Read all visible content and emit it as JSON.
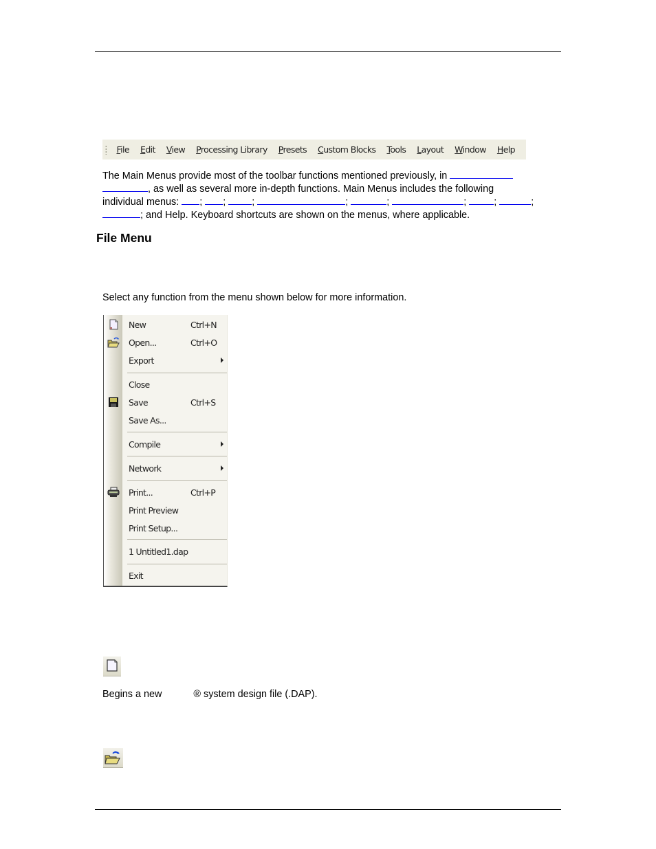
{
  "menubar": {
    "items": [
      "File",
      "Edit",
      "View",
      "Processing Library",
      "Presets",
      "Custom Blocks",
      "Tools",
      "Layout",
      "Window",
      "Help"
    ]
  },
  "intro": {
    "line1": "The Main Menus provide most of the toolbar functions mentioned previously, in ",
    "line2": ", as well as several more in-depth functions. Main Menus includes the following",
    "line3": "individual menus: ",
    "sep": ";",
    "line4": "; and Help. Keyboard shortcuts are shown on the menus, where applicable."
  },
  "file_menu_heading": "File Menu",
  "select_text": "Select any function from the menu shown below for more information.",
  "file_menu": {
    "items": [
      {
        "label": "New",
        "shortcut": "Ctrl+N",
        "icon": "new-document-icon",
        "submenu": false
      },
      {
        "label": "Open...",
        "shortcut": "Ctrl+O",
        "icon": "open-folder-icon",
        "submenu": false
      },
      {
        "label": "Export",
        "shortcut": "",
        "icon": "",
        "submenu": true
      },
      {
        "label": "Close",
        "shortcut": "",
        "icon": "",
        "submenu": false
      },
      {
        "label": "Save",
        "shortcut": "Ctrl+S",
        "icon": "floppy-disk-icon",
        "submenu": false
      },
      {
        "label": "Save As...",
        "shortcut": "",
        "icon": "",
        "submenu": false
      },
      {
        "label": "Compile",
        "shortcut": "",
        "icon": "",
        "submenu": true
      },
      {
        "label": "Network",
        "shortcut": "",
        "icon": "",
        "submenu": true
      },
      {
        "label": "Print...",
        "shortcut": "Ctrl+P",
        "icon": "printer-icon",
        "submenu": false
      },
      {
        "label": "Print Preview",
        "shortcut": "",
        "icon": "",
        "submenu": false
      },
      {
        "label": "Print Setup...",
        "shortcut": "",
        "icon": "",
        "submenu": false
      },
      {
        "label": "1 Untitled1.dap",
        "shortcut": "",
        "icon": "",
        "submenu": false
      },
      {
        "label": "Exit",
        "shortcut": "",
        "icon": "",
        "submenu": false
      }
    ]
  },
  "new_description": {
    "before": "Begins a new",
    "after": "® system design file (.DAP)."
  },
  "colors": {
    "link": "#0000ee",
    "menubar_bg": "#efeee3"
  }
}
